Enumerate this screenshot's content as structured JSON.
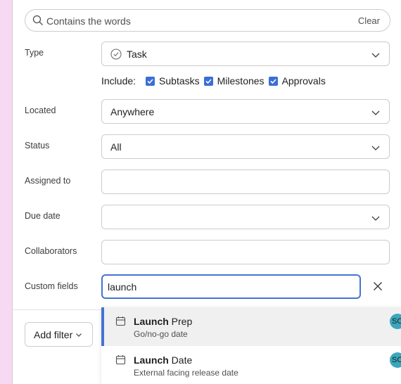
{
  "search": {
    "placeholder": "Contains the words",
    "clear_label": "Clear"
  },
  "filters": {
    "type": {
      "label": "Type",
      "value": "Task"
    },
    "include": {
      "label": "Include:",
      "options": [
        {
          "label": "Subtasks",
          "checked": true
        },
        {
          "label": "Milestones",
          "checked": true
        },
        {
          "label": "Approvals",
          "checked": true
        }
      ]
    },
    "located": {
      "label": "Located",
      "value": "Anywhere"
    },
    "status": {
      "label": "Status",
      "value": "All"
    },
    "assigned_to": {
      "label": "Assigned to",
      "value": ""
    },
    "due_date": {
      "label": "Due date",
      "value": ""
    },
    "collaborators": {
      "label": "Collaborators",
      "value": ""
    },
    "custom_fields": {
      "label": "Custom fields",
      "value": "launch"
    }
  },
  "add_filter_label": "Add filter",
  "suggestions": [
    {
      "bold": "Launch",
      "rest": " Prep",
      "subtitle": "Go/no-go date",
      "avatar": "SO",
      "selected": true
    },
    {
      "bold": "Launch",
      "rest": " Date",
      "subtitle": "External facing release date",
      "avatar": "SO",
      "selected": false
    }
  ],
  "colors": {
    "accent": "#4573d2",
    "checkbox": "#3b6fd6",
    "avatar": "#3aa7bd",
    "page_bg": "#f7d9f4"
  }
}
